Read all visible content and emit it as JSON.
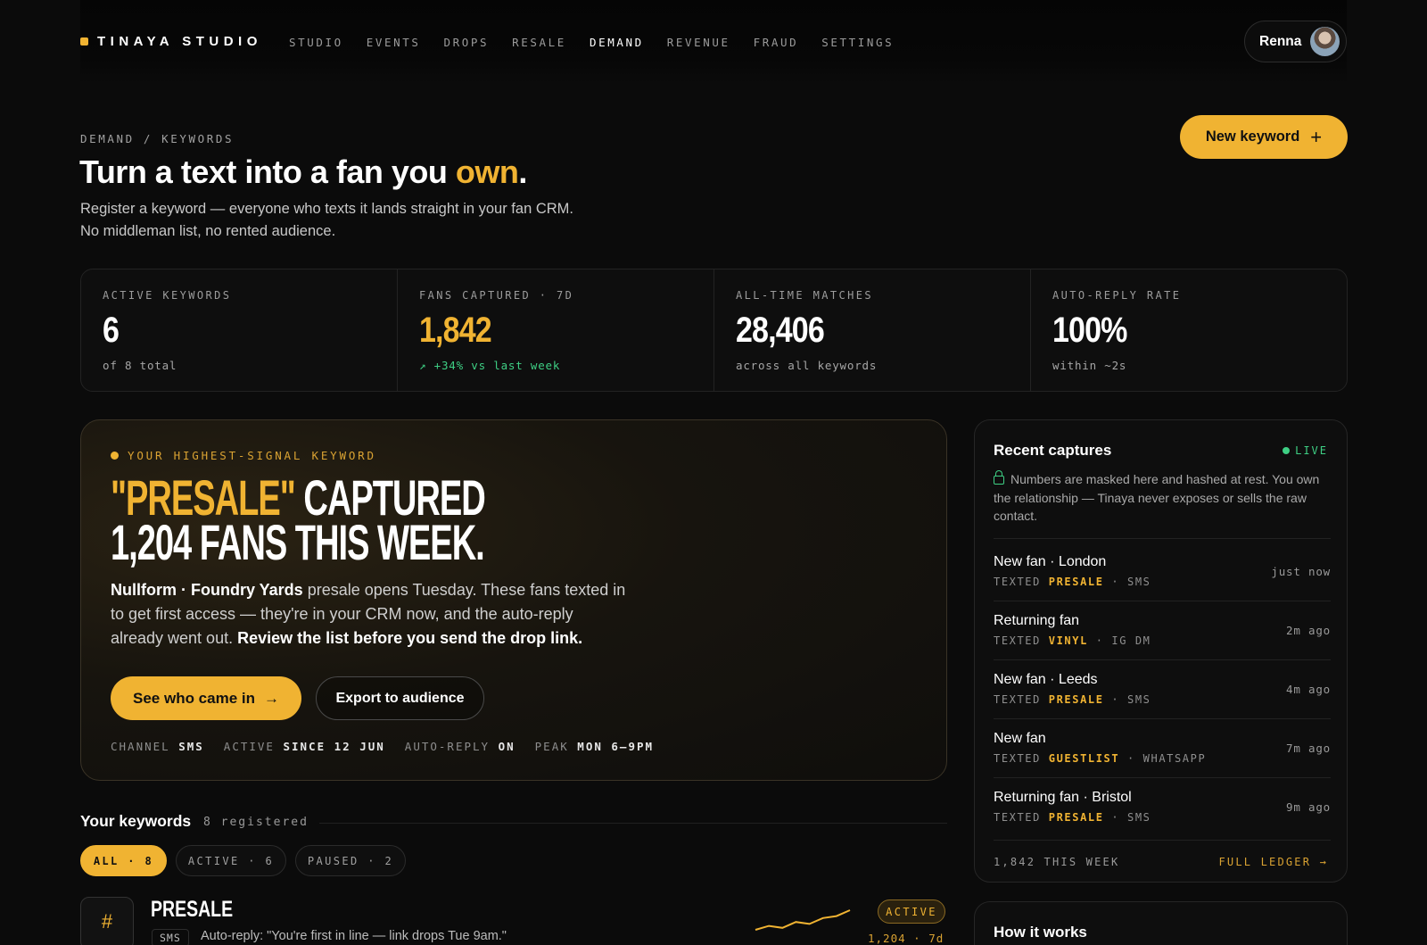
{
  "brand": {
    "name": "TINAYA STUDIO",
    "accent": "#f0b332"
  },
  "nav": {
    "items": [
      {
        "label": "STUDIO"
      },
      {
        "label": "EVENTS"
      },
      {
        "label": "DROPS"
      },
      {
        "label": "RESALE"
      },
      {
        "label": "DEMAND",
        "active": true
      },
      {
        "label": "REVENUE"
      },
      {
        "label": "FRAUD"
      },
      {
        "label": "SETTINGS"
      }
    ]
  },
  "user": {
    "name": "Renna"
  },
  "header": {
    "breadcrumb": "DEMAND / KEYWORDS",
    "title_main": "Turn a text into a fan you ",
    "title_accent": "own",
    "title_end": ".",
    "subtitle": "Register a keyword — everyone who texts it lands straight in your fan CRM. No middleman list, no rented audience.",
    "new_keyword_label": "New keyword"
  },
  "stats": [
    {
      "label": "ACTIVE KEYWORDS",
      "value": "6",
      "note": "of 8 total"
    },
    {
      "label": "FANS CAPTURED · 7D",
      "value": "1,842",
      "note": "↗ +34% vs last week"
    },
    {
      "label": "ALL-TIME MATCHES",
      "value": "28,406",
      "note": "across all keywords"
    },
    {
      "label": "AUTO-REPLY RATE",
      "value": "100%",
      "note": "within ~2s"
    }
  ],
  "hero": {
    "eyebrow": "YOUR HIGHEST-SIGNAL KEYWORD",
    "keyword": "\"PRESALE\"",
    "head_rest": " CAPTURED",
    "head_line2": "1,204 FANS THIS WEEK.",
    "body_bold1": "Nullform · Foundry Yards",
    "body_text1": " presale opens Tuesday. These fans texted in to get first access — they're in your CRM now, and the auto-reply already went out. ",
    "body_bold2": "Review the list before you send the drop link.",
    "primary_label": "See who came in",
    "secondary_label": "Export to audience",
    "meta": [
      {
        "key": "CHANNEL",
        "value": "SMS"
      },
      {
        "key": "ACTIVE",
        "value": "SINCE 12 JUN"
      },
      {
        "key": "AUTO-REPLY",
        "value": "ON"
      },
      {
        "key": "PEAK",
        "value": "MON 6–9PM"
      }
    ]
  },
  "keywords": {
    "title": "Your keywords",
    "count": "8 registered",
    "filters": [
      {
        "label": "ALL · 8",
        "active": true
      },
      {
        "label": "ACTIVE · 6"
      },
      {
        "label": "PAUSED · 2"
      }
    ],
    "items": [
      {
        "hash": "#",
        "name": "PRESALE",
        "channel": "SMS",
        "reply": "Auto-reply: \"You're first in line — link drops Tue 9am.\"",
        "status": "ACTIVE",
        "stat": "1,204 · 7d",
        "trend": [
          2,
          3,
          2.5,
          4,
          3.5,
          5,
          5.5,
          7
        ]
      }
    ]
  },
  "captures": {
    "title": "Recent captures",
    "live_label": "LIVE",
    "note": "Numbers are masked here and hashed at rest. You own the relationship — Tinaya never exposes or sells the raw contact.",
    "rows": [
      {
        "who": "New fan · London",
        "prefix": "TEXTED ",
        "keyword": "PRESALE",
        "channel": " · SMS",
        "time": "just now"
      },
      {
        "who": "Returning fan",
        "prefix": "TEXTED ",
        "keyword": "VINYL",
        "channel": " · IG DM",
        "time": "2m ago"
      },
      {
        "who": "New fan · Leeds",
        "prefix": "TEXTED ",
        "keyword": "PRESALE",
        "channel": " · SMS",
        "time": "4m ago"
      },
      {
        "who": "New fan",
        "prefix": "TEXTED ",
        "keyword": "GUESTLIST",
        "channel": " · WHATSAPP",
        "time": "7m ago"
      },
      {
        "who": "Returning fan · Bristol",
        "prefix": "TEXTED ",
        "keyword": "PRESALE",
        "channel": " · SMS",
        "time": "9m ago"
      }
    ],
    "footer_count": "1,842 THIS WEEK",
    "footer_link": "FULL LEDGER →"
  },
  "how": {
    "title": "How it works"
  }
}
